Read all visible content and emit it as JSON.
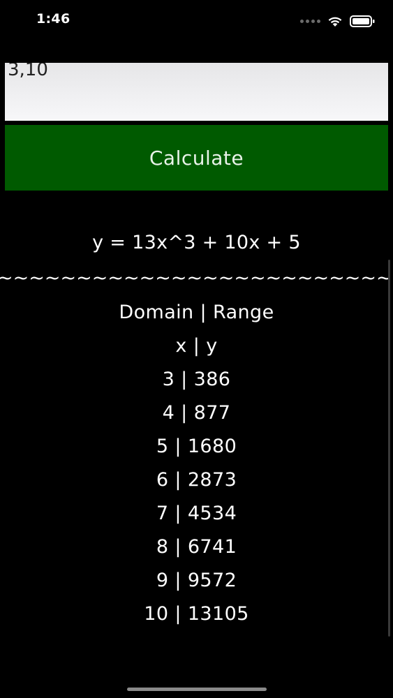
{
  "status_bar": {
    "time": "1:46"
  },
  "input": {
    "value": "3,10"
  },
  "calculate_button": {
    "label": "Calculate"
  },
  "result": {
    "equation": "y = 13x^3 + 10x + 5",
    "divider": "~~~~~~~~~~~~~~~~~~~~~~~~~~~~~~~~~~~~~~~~",
    "header": "Domain | Range",
    "subheader": "x | y",
    "rows": [
      "3 | 386",
      "4 | 877",
      "5 | 1680",
      "6 | 2873",
      "7 | 4534",
      "8 | 6741",
      "9 | 9572",
      "10 | 13105"
    ]
  },
  "colors": {
    "background": "#000000",
    "button": "#005a00",
    "text": "#ffffff"
  }
}
